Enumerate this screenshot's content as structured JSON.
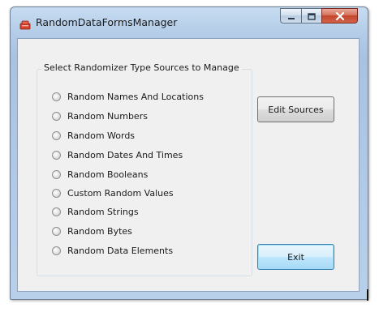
{
  "window": {
    "title": "RandomDataFormsManager",
    "icon": "database-icon",
    "controls": {
      "minimize_icon": "minimize-icon",
      "maximize_icon": "maximize-icon",
      "close_icon": "close-icon"
    }
  },
  "group": {
    "caption": "Select Randomizer Type Sources to Manage",
    "options": [
      {
        "label": "Random Names And Locations",
        "selected": false
      },
      {
        "label": "Random Numbers",
        "selected": false
      },
      {
        "label": "Random Words",
        "selected": false
      },
      {
        "label": "Random Dates And Times",
        "selected": false
      },
      {
        "label": "Random Booleans",
        "selected": false
      },
      {
        "label": "Custom Random Values",
        "selected": false
      },
      {
        "label": "Random Strings",
        "selected": false
      },
      {
        "label": "Random Bytes",
        "selected": false
      },
      {
        "label": "Random Data Elements",
        "selected": false
      }
    ]
  },
  "buttons": {
    "edit_sources": "Edit Sources",
    "exit": "Exit"
  },
  "colors": {
    "frame": "#b9d0ea",
    "client": "#f0f0f0",
    "close_button": "#c4442b",
    "default_button_border": "#3c7fb1"
  }
}
